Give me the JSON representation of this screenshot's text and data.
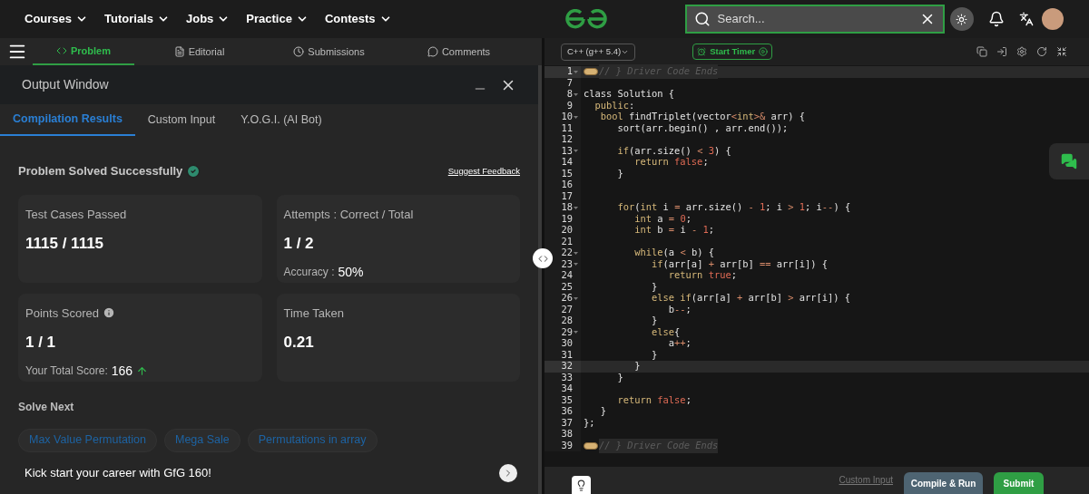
{
  "nav": {
    "menus": [
      "Courses",
      "Tutorials",
      "Jobs",
      "Practice",
      "Contests"
    ],
    "search": {
      "placeholder": "Search..."
    }
  },
  "problem_tabs": [
    {
      "label": "Problem",
      "selected": true,
      "kind": "code"
    },
    {
      "label": "Editorial",
      "selected": false,
      "kind": "doc"
    },
    {
      "label": "Submissions",
      "selected": false,
      "kind": "clock"
    },
    {
      "label": "Comments",
      "selected": false,
      "kind": "chat"
    }
  ],
  "output_window": {
    "title": "Output Window",
    "tabs": [
      {
        "label": "Compilation Results",
        "selected": true
      },
      {
        "label": "Custom Input",
        "selected": false
      },
      {
        "label": "Y.O.G.I. (AI Bot)",
        "selected": false
      }
    ],
    "status": "Problem Solved Successfully",
    "feedback_link": "Suggest Feedback",
    "cards": [
      {
        "label": "Test Cases Passed",
        "value": "1115 / 1115",
        "info": false
      },
      {
        "label": "Attempts : Correct / Total",
        "value": "1 / 2",
        "info": false,
        "note_label": "Accuracy :",
        "note_value": "50%",
        "trend_up": false
      },
      {
        "label": "Points Scored",
        "value": "1 / 1",
        "info": true,
        "note_label": "Your Total Score:",
        "note_value": "166",
        "trend_up": true
      },
      {
        "label": "Time Taken",
        "value": "0.21",
        "info": false
      }
    ],
    "solve_next": {
      "title": "Solve Next",
      "problems": [
        "Max Value Permutation",
        "Mega Sale",
        "Permutations in array"
      ]
    },
    "promo": "Kick start your career with GfG 160!"
  },
  "editor": {
    "language": "C++ (g++ 5.4)",
    "timer": "Start Timer",
    "lines": [
      {
        "number": "1",
        "fold": true,
        "highlighted": true,
        "tokens": [
          {
            "kind": "widget"
          },
          {
            "kind": "comment",
            "text": "// } Driver Code Ends"
          }
        ]
      },
      {
        "number": "7",
        "fold": false,
        "highlighted": false
      },
      {
        "number": "8",
        "fold": true,
        "highlighted": false,
        "tokens": [
          {
            "kind": "plain",
            "text": "class Solution {"
          }
        ]
      },
      {
        "number": "9",
        "fold": false,
        "highlighted": false,
        "tokens": [
          {
            "kind": "keyword",
            "text": "  public"
          },
          {
            "kind": "plain",
            "text": ":"
          }
        ]
      },
      {
        "number": "10",
        "fold": true,
        "highlighted": false,
        "tokens": [
          {
            "kind": "keyword",
            "text": "   bool"
          },
          {
            "kind": "plain",
            "text": " findTriplet(vector"
          },
          {
            "kind": "op",
            "text": "<"
          },
          {
            "kind": "keyword",
            "text": "int"
          },
          {
            "kind": "op",
            "text": ">&"
          },
          {
            "kind": "plain",
            "text": " arr) {"
          }
        ]
      },
      {
        "number": "11",
        "fold": false,
        "highlighted": false,
        "tokens": [
          {
            "kind": "plain",
            "text": "      sort(arr.begin() , arr.end());"
          }
        ]
      },
      {
        "number": "12",
        "fold": false,
        "highlighted": false
      },
      {
        "number": "13",
        "fold": true,
        "highlighted": false,
        "tokens": [
          {
            "kind": "keyword",
            "text": "      if"
          },
          {
            "kind": "plain",
            "text": "(arr.size() "
          },
          {
            "kind": "op",
            "text": "<"
          },
          {
            "kind": "literal",
            "text": " 3"
          },
          {
            "kind": "plain",
            "text": ") {"
          }
        ]
      },
      {
        "number": "14",
        "fold": false,
        "highlighted": false,
        "tokens": [
          {
            "kind": "keyword",
            "text": "         return"
          },
          {
            "kind": "literal",
            "text": " false"
          },
          {
            "kind": "plain",
            "text": ";"
          }
        ]
      },
      {
        "number": "15",
        "fold": false,
        "highlighted": false,
        "tokens": [
          {
            "kind": "plain",
            "text": "      }"
          }
        ]
      },
      {
        "number": "16",
        "fold": false,
        "highlighted": false
      },
      {
        "number": "17",
        "fold": false,
        "highlighted": false
      },
      {
        "number": "18",
        "fold": true,
        "highlighted": false,
        "tokens": [
          {
            "kind": "keyword",
            "text": "      for"
          },
          {
            "kind": "plain",
            "text": "("
          },
          {
            "kind": "keyword",
            "text": "int"
          },
          {
            "kind": "plain",
            "text": " i "
          },
          {
            "kind": "op",
            "text": "="
          },
          {
            "kind": "plain",
            "text": " arr.size() "
          },
          {
            "kind": "op",
            "text": "-"
          },
          {
            "kind": "literal",
            "text": " 1"
          },
          {
            "kind": "plain",
            "text": "; i "
          },
          {
            "kind": "op",
            "text": ">"
          },
          {
            "kind": "literal",
            "text": " 1"
          },
          {
            "kind": "plain",
            "text": "; i"
          },
          {
            "kind": "op",
            "text": "--"
          },
          {
            "kind": "plain",
            "text": ") {"
          }
        ]
      },
      {
        "number": "19",
        "fold": false,
        "highlighted": false,
        "tokens": [
          {
            "kind": "keyword",
            "text": "         int"
          },
          {
            "kind": "plain",
            "text": " a "
          },
          {
            "kind": "op",
            "text": "="
          },
          {
            "kind": "literal",
            "text": " 0"
          },
          {
            "kind": "plain",
            "text": ";"
          }
        ]
      },
      {
        "number": "20",
        "fold": false,
        "highlighted": false,
        "tokens": [
          {
            "kind": "keyword",
            "text": "         int"
          },
          {
            "kind": "plain",
            "text": " b "
          },
          {
            "kind": "op",
            "text": "="
          },
          {
            "kind": "plain",
            "text": " i "
          },
          {
            "kind": "op",
            "text": "-"
          },
          {
            "kind": "literal",
            "text": " 1"
          },
          {
            "kind": "plain",
            "text": ";"
          }
        ]
      },
      {
        "number": "21",
        "fold": false,
        "highlighted": false
      },
      {
        "number": "22",
        "fold": true,
        "highlighted": false,
        "tokens": [
          {
            "kind": "keyword",
            "text": "         while"
          },
          {
            "kind": "plain",
            "text": "(a "
          },
          {
            "kind": "op",
            "text": "<"
          },
          {
            "kind": "plain",
            "text": " b) {"
          }
        ]
      },
      {
        "number": "23",
        "fold": true,
        "highlighted": false,
        "tokens": [
          {
            "kind": "keyword",
            "text": "            if"
          },
          {
            "kind": "plain",
            "text": "(arr[a] "
          },
          {
            "kind": "op",
            "text": "+"
          },
          {
            "kind": "plain",
            "text": " arr[b] "
          },
          {
            "kind": "op",
            "text": "=="
          },
          {
            "kind": "plain",
            "text": " arr[i]) {"
          }
        ]
      },
      {
        "number": "24",
        "fold": false,
        "highlighted": false,
        "tokens": [
          {
            "kind": "keyword",
            "text": "               return"
          },
          {
            "kind": "literal",
            "text": " true"
          },
          {
            "kind": "plain",
            "text": ";"
          }
        ]
      },
      {
        "number": "25",
        "fold": false,
        "highlighted": false,
        "tokens": [
          {
            "kind": "plain",
            "text": "            }"
          }
        ]
      },
      {
        "number": "26",
        "fold": true,
        "highlighted": false,
        "tokens": [
          {
            "kind": "keyword",
            "text": "            else if"
          },
          {
            "kind": "plain",
            "text": "(arr[a] "
          },
          {
            "kind": "op",
            "text": "+"
          },
          {
            "kind": "plain",
            "text": " arr[b] "
          },
          {
            "kind": "op",
            "text": ">"
          },
          {
            "kind": "plain",
            "text": " arr[i]) {"
          }
        ]
      },
      {
        "number": "27",
        "fold": false,
        "highlighted": false,
        "tokens": [
          {
            "kind": "plain",
            "text": "               b"
          },
          {
            "kind": "op",
            "text": "--"
          },
          {
            "kind": "plain",
            "text": ";"
          }
        ]
      },
      {
        "number": "28",
        "fold": false,
        "highlighted": false,
        "tokens": [
          {
            "kind": "plain",
            "text": "            }"
          }
        ]
      },
      {
        "number": "29",
        "fold": true,
        "highlighted": false,
        "tokens": [
          {
            "kind": "keyword",
            "text": "            else"
          },
          {
            "kind": "plain",
            "text": "{"
          }
        ]
      },
      {
        "number": "30",
        "fold": false,
        "highlighted": false,
        "tokens": [
          {
            "kind": "plain",
            "text": "               a"
          },
          {
            "kind": "op",
            "text": "++"
          },
          {
            "kind": "plain",
            "text": ";"
          }
        ]
      },
      {
        "number": "31",
        "fold": false,
        "highlighted": false,
        "tokens": [
          {
            "kind": "plain",
            "text": "            }"
          }
        ]
      },
      {
        "number": "32",
        "fold": false,
        "highlighted": true,
        "tokens": [
          {
            "kind": "plain",
            "text": "         }"
          }
        ]
      },
      {
        "number": "33",
        "fold": false,
        "highlighted": false,
        "tokens": [
          {
            "kind": "plain",
            "text": "      }"
          }
        ]
      },
      {
        "number": "34",
        "fold": false,
        "highlighted": false
      },
      {
        "number": "35",
        "fold": false,
        "highlighted": false,
        "tokens": [
          {
            "kind": "keyword",
            "text": "      return"
          },
          {
            "kind": "literal",
            "text": " false"
          },
          {
            "kind": "plain",
            "text": ";"
          }
        ]
      },
      {
        "number": "36",
        "fold": false,
        "highlighted": false,
        "tokens": [
          {
            "kind": "plain",
            "text": "   }"
          }
        ]
      },
      {
        "number": "37",
        "fold": false,
        "highlighted": false,
        "tokens": [
          {
            "kind": "plain",
            "text": "};"
          }
        ]
      },
      {
        "number": "38",
        "fold": false,
        "highlighted": false
      },
      {
        "number": "39",
        "fold": false,
        "highlighted": false,
        "tokens": [
          {
            "kind": "widget"
          },
          {
            "kind": "comment",
            "text": "// } Driver Code Ends"
          }
        ]
      }
    ],
    "custom_input_link": "Custom Input",
    "compile_button": "Compile & Run",
    "submit_button": "Submit"
  }
}
